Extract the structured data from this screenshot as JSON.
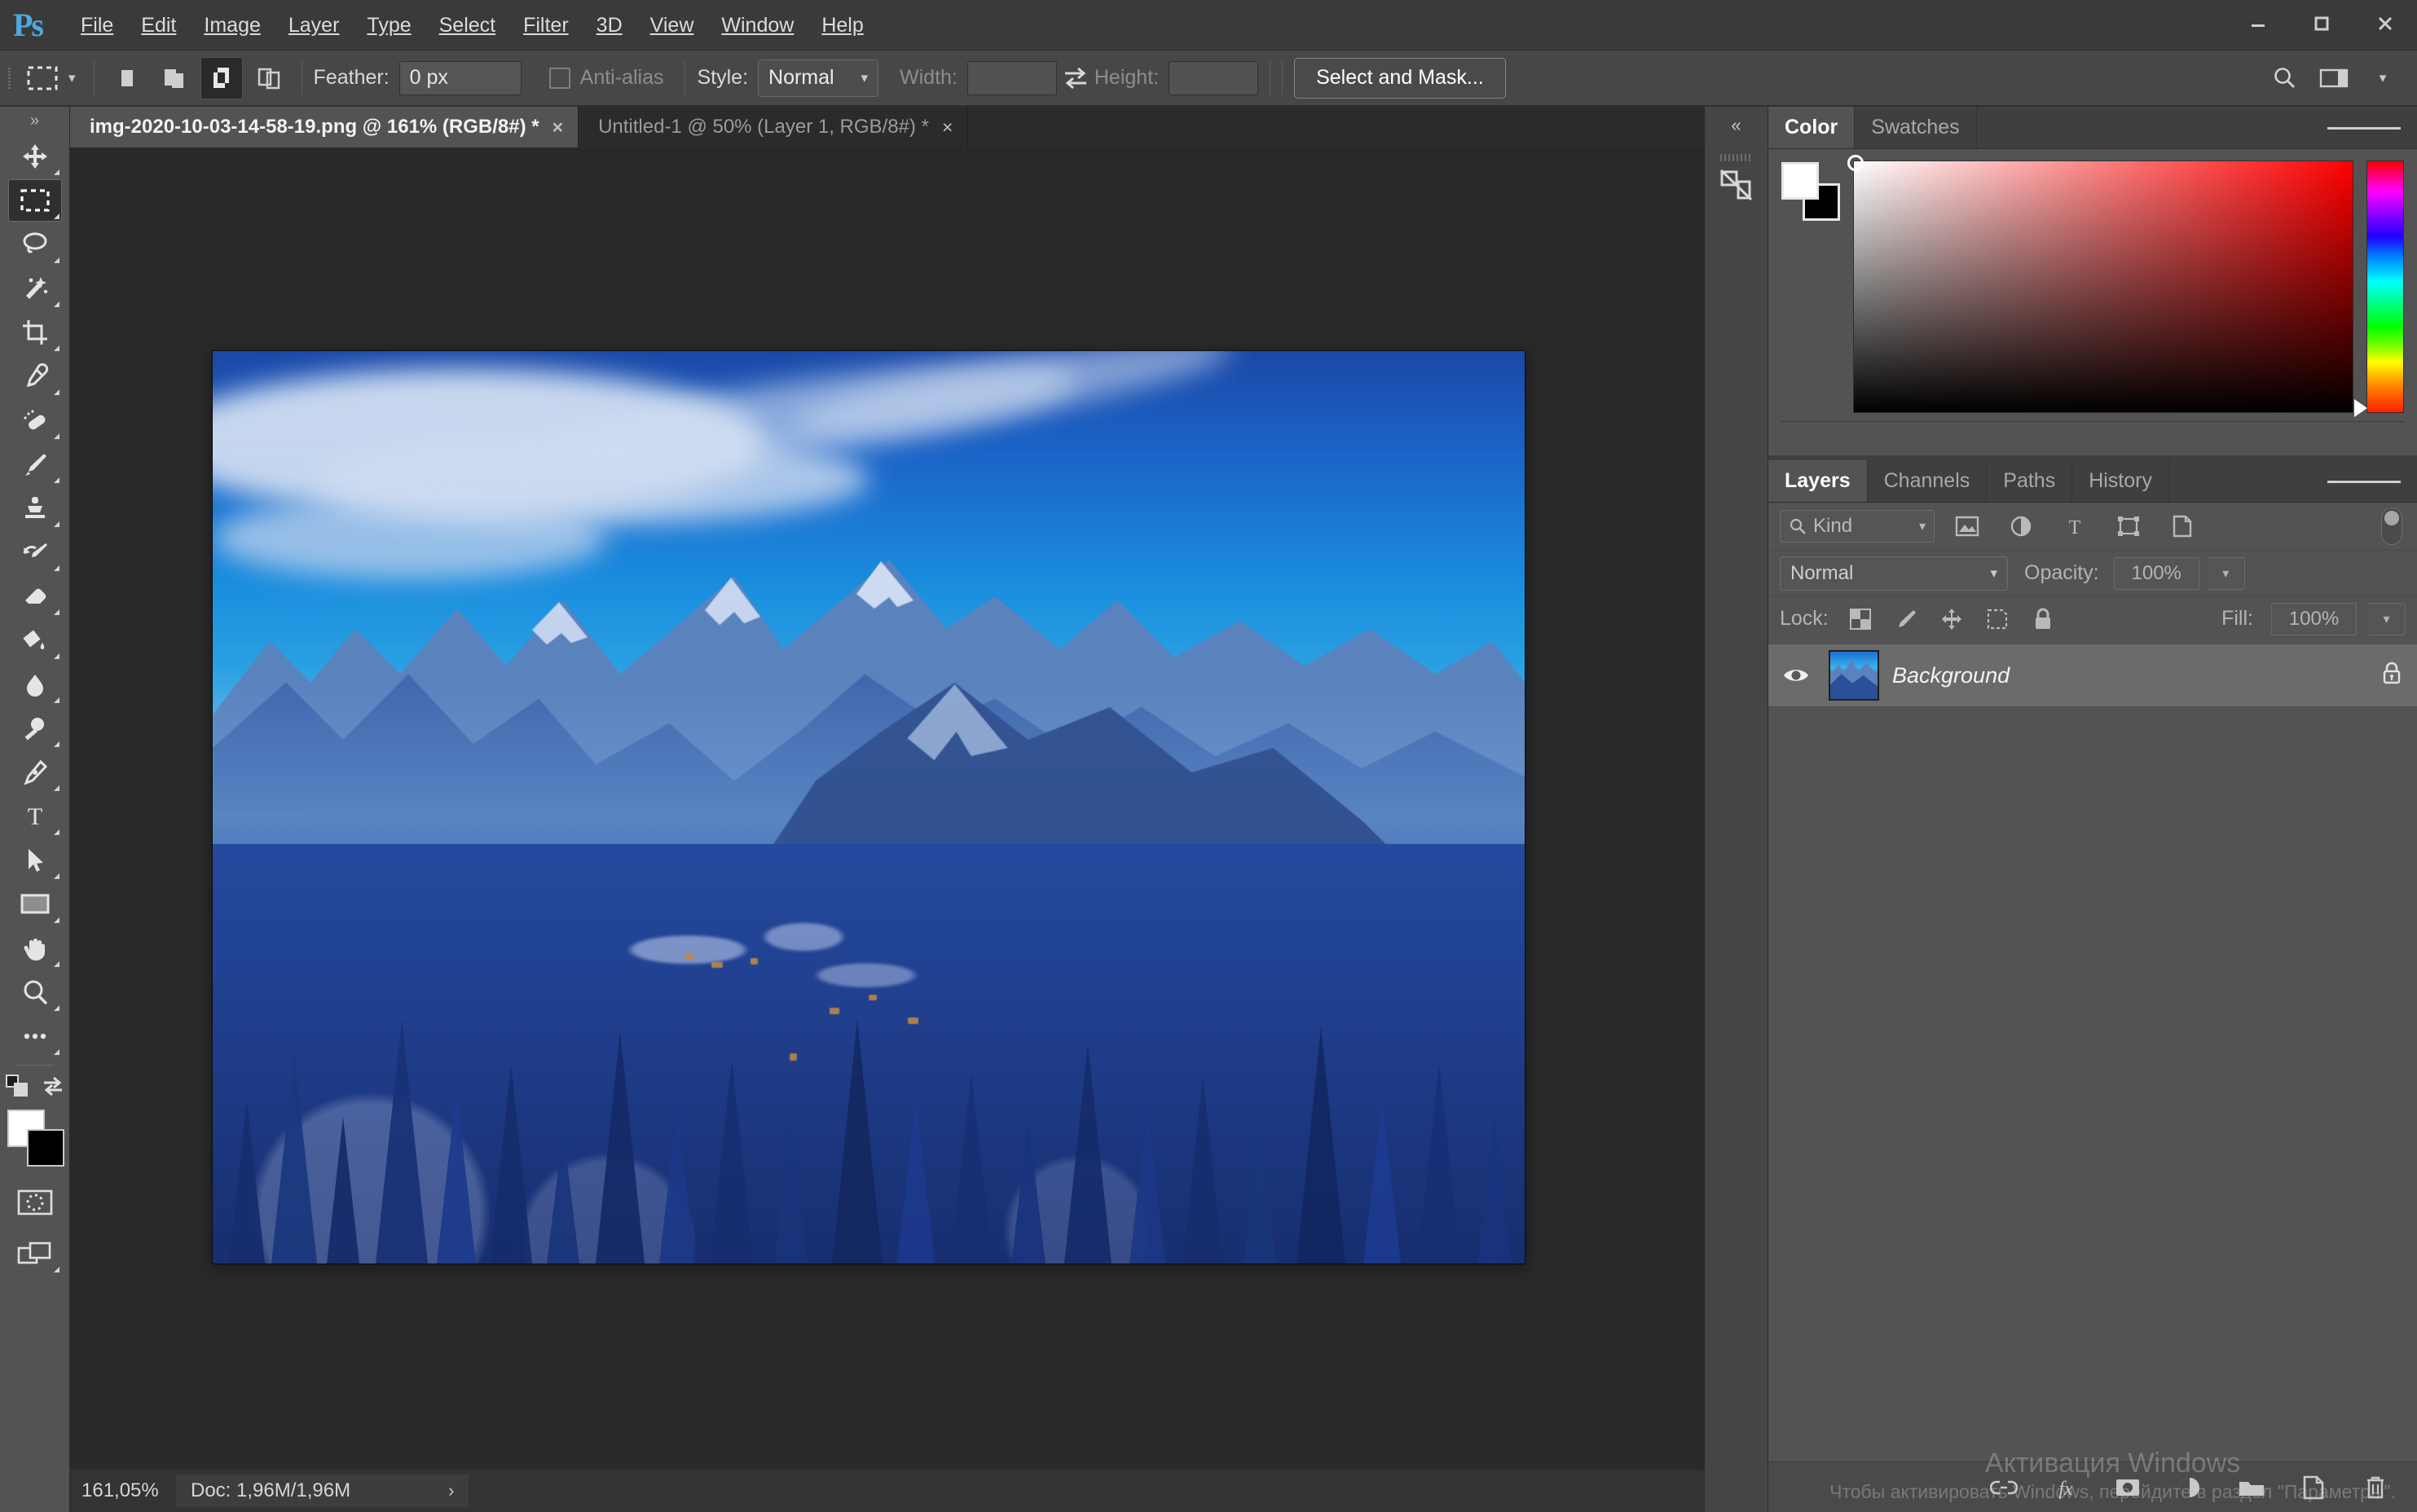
{
  "app": {
    "logo": "Ps",
    "menus": [
      "File",
      "Edit",
      "Image",
      "Layer",
      "Type",
      "Select",
      "Filter",
      "3D",
      "View",
      "Window",
      "Help"
    ],
    "window_controls": {
      "minimize": "minimize-icon",
      "maximize": "maximize-icon",
      "close": "close-icon"
    }
  },
  "options_bar": {
    "tool_preset_icon": "rectangular-marquee-icon",
    "boolean_modes": [
      "new-selection",
      "add-to-selection",
      "subtract-from-selection",
      "intersect-with-selection"
    ],
    "active_boolean_index": 2,
    "feather_label": "Feather:",
    "feather_value": "0 px",
    "antialias_label": "Anti-alias",
    "antialias_checked": false,
    "style_label": "Style:",
    "style_value": "Normal",
    "width_label": "Width:",
    "width_value": "",
    "height_label": "Height:",
    "height_value": "",
    "swap_icon": "swap-width-height-icon",
    "select_and_mask": "Select and Mask...",
    "right_icons": [
      "search-icon",
      "workspace-switcher-icon",
      "chevron-down-icon"
    ]
  },
  "tabs": [
    {
      "label": "img-2020-10-03-14-58-19.png @ 161% (RGB/8#) *",
      "active": true,
      "close": "×"
    },
    {
      "label": "Untitled-1 @ 50% (Layer 1, RGB/8#) *",
      "active": false,
      "close": "×"
    }
  ],
  "toolbar": {
    "tools": [
      {
        "name": "move-tool",
        "has_corner": true,
        "active": false
      },
      {
        "name": "rectangular-marquee-tool",
        "has_corner": true,
        "active": true
      },
      {
        "name": "lasso-tool",
        "has_corner": true,
        "active": false
      },
      {
        "name": "magic-wand-tool",
        "has_corner": true,
        "active": false
      },
      {
        "name": "crop-tool",
        "has_corner": true,
        "active": false
      },
      {
        "name": "eyedropper-tool",
        "has_corner": true,
        "active": false
      },
      {
        "name": "spot-healing-brush-tool",
        "has_corner": true,
        "active": false
      },
      {
        "name": "brush-tool",
        "has_corner": true,
        "active": false
      },
      {
        "name": "clone-stamp-tool",
        "has_corner": true,
        "active": false
      },
      {
        "name": "history-brush-tool",
        "has_corner": true,
        "active": false
      },
      {
        "name": "eraser-tool",
        "has_corner": true,
        "active": false
      },
      {
        "name": "gradient-tool",
        "has_corner": true,
        "active": false
      },
      {
        "name": "blur-tool",
        "has_corner": true,
        "active": false
      },
      {
        "name": "dodge-tool",
        "has_corner": true,
        "active": false
      },
      {
        "name": "pen-tool",
        "has_corner": true,
        "active": false
      },
      {
        "name": "type-tool",
        "has_corner": true,
        "active": false
      },
      {
        "name": "path-selection-tool",
        "has_corner": true,
        "active": false
      },
      {
        "name": "rectangle-tool",
        "has_corner": true,
        "active": false
      },
      {
        "name": "hand-tool",
        "has_corner": true,
        "active": false
      },
      {
        "name": "zoom-tool",
        "has_corner": true,
        "active": false
      },
      {
        "name": "edit-toolbar-tool",
        "has_corner": true,
        "active": false
      }
    ],
    "foreground_color": "#ffffff",
    "background_color": "#000000",
    "quick_mask_icon": "quick-mask-icon",
    "screen_mode_icon": "screen-mode-icon"
  },
  "status_bar": {
    "zoom": "161,05%",
    "doc_info": "Doc: 1,96M/1,96M",
    "expand_arrow": "›"
  },
  "color_panel": {
    "tabs": [
      {
        "label": "Color",
        "active": true
      },
      {
        "label": "Swatches",
        "active": false
      }
    ],
    "foreground_color": "#ffffff",
    "background_color": "#000000",
    "ramp_base_hue": "#ff0000",
    "menu_icon": "panel-menu-icon"
  },
  "layers_panel": {
    "tabs": [
      {
        "label": "Layers",
        "active": true
      },
      {
        "label": "Channels",
        "active": false
      },
      {
        "label": "Paths",
        "active": false
      },
      {
        "label": "History",
        "active": false
      }
    ],
    "filter_label": "Kind",
    "filter_icons": [
      "pixel-layer-filter-icon",
      "adjustment-layer-filter-icon",
      "type-layer-filter-icon",
      "shape-layer-filter-icon",
      "smart-object-filter-icon"
    ],
    "filter_toggle_on": false,
    "blend_mode": "Normal",
    "opacity_label": "Opacity:",
    "opacity_value": "100%",
    "lock_label": "Lock:",
    "lock_icons": [
      "lock-transparent-pixels-icon",
      "lock-image-pixels-icon",
      "lock-position-icon",
      "lock-artboard-nesting-icon",
      "lock-all-icon"
    ],
    "fill_label": "Fill:",
    "fill_value": "100%",
    "layers": [
      {
        "name": "Background",
        "visible": true,
        "locked": true,
        "thumb": "winter-mountain-thumbnail"
      }
    ],
    "footer_icons": [
      "link-layers-icon",
      "layer-style-fx-icon",
      "add-layer-mask-icon",
      "new-adjustment-layer-icon",
      "new-group-icon",
      "new-layer-icon",
      "delete-layer-icon"
    ],
    "menu_icon": "panel-menu-icon"
  },
  "dock_rail": {
    "collapse_icon": "collapse-panels-icon",
    "icons": [
      "histogram-panel-icon"
    ]
  },
  "canvas": {
    "document_title": "img-2020-10-03-14-58-19.png",
    "zoom_percent": "161%",
    "color_mode": "RGB/8#",
    "selection_active": true,
    "artwork_description": "Winter alpine landscape: snow-covered mountain peaks, blue sky with wispy clouds, frozen lake, dense snowy conifer forest and a small village"
  },
  "watermark": {
    "line1": "Активация Windows",
    "line2": "Чтобы активировать Windows, перейдите в раздел \"Параметры\"."
  },
  "colors": {
    "chrome": "#535353",
    "chrome_dark": "#3f3f3f",
    "canvas_bg": "#292929",
    "accent_blue": "#4fa8e0",
    "text": "#d4d4d4"
  }
}
